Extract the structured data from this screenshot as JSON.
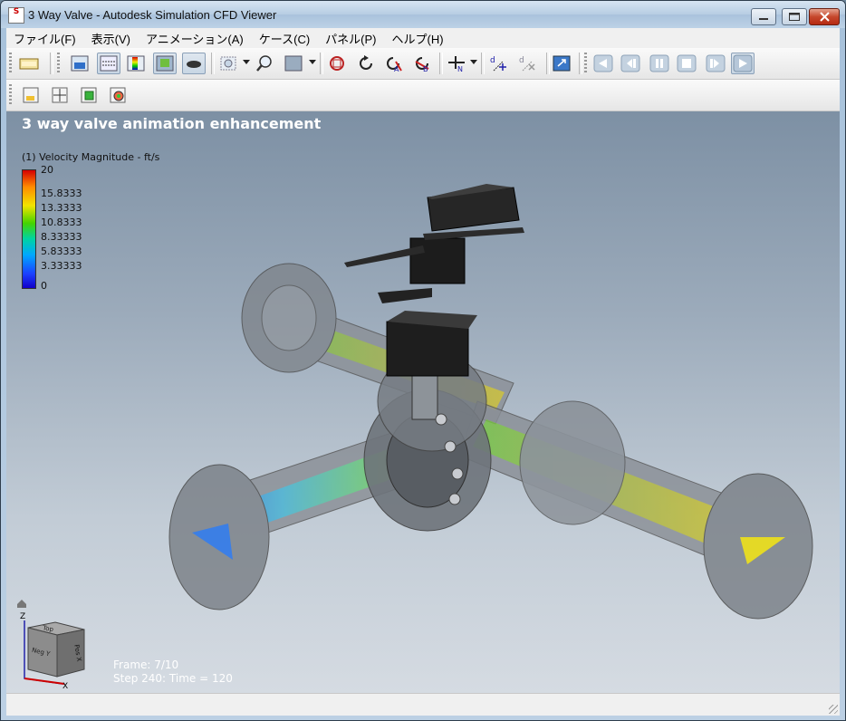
{
  "window": {
    "title": "3 Way Valve - Autodesk Simulation CFD Viewer",
    "app_icon_text": "S"
  },
  "menubar": {
    "items": [
      {
        "label": "ファイル(F)"
      },
      {
        "label": "表示(V)"
      },
      {
        "label": "アニメーション(A)"
      },
      {
        "label": "ケース(C)"
      },
      {
        "label": "パネル(P)"
      },
      {
        "label": "ヘルプ(H)"
      }
    ]
  },
  "toolbar": {
    "icons": [
      "open-icon",
      "front-view-icon",
      "top-view-icon",
      "colorbar-icon",
      "shaded-view-icon",
      "shadow-icon",
      "fit-view-icon",
      "zoom-icon",
      "background-icon",
      "reset-view-icon",
      "rotate-icon",
      "rotate-about-a-icon",
      "rotate-about-b-icon",
      "normal-to-icon",
      "move-icon",
      "delete-point-icon",
      "fullscreen-icon",
      "play-reverse-icon",
      "step-back-icon",
      "pause-icon",
      "stop-icon",
      "step-forward-icon",
      "play-icon"
    ]
  },
  "toolbar2": {
    "icons": [
      "plane-icon",
      "cross-section-icon",
      "iso-surface-icon",
      "wall-result-icon"
    ]
  },
  "viewport": {
    "title": "3 way valve animation enhancement",
    "legend": {
      "title": "(1) Velocity Magnitude - ft/s",
      "labels": [
        "20",
        "15.8333",
        "13.3333",
        "10.8333",
        "8.33333",
        "5.83333",
        "3.33333",
        "0"
      ]
    },
    "frame_label": "Frame:   7/10",
    "step_label": "Step 240:  Time = 120",
    "view_cube": {
      "top_face": "Top",
      "front_face": "Neg Y",
      "right_face": "Pos X",
      "axis_z": "Z",
      "axis_x": "X"
    }
  },
  "colors": {
    "accent": "#1b40ff",
    "max_color": "#d40000"
  }
}
